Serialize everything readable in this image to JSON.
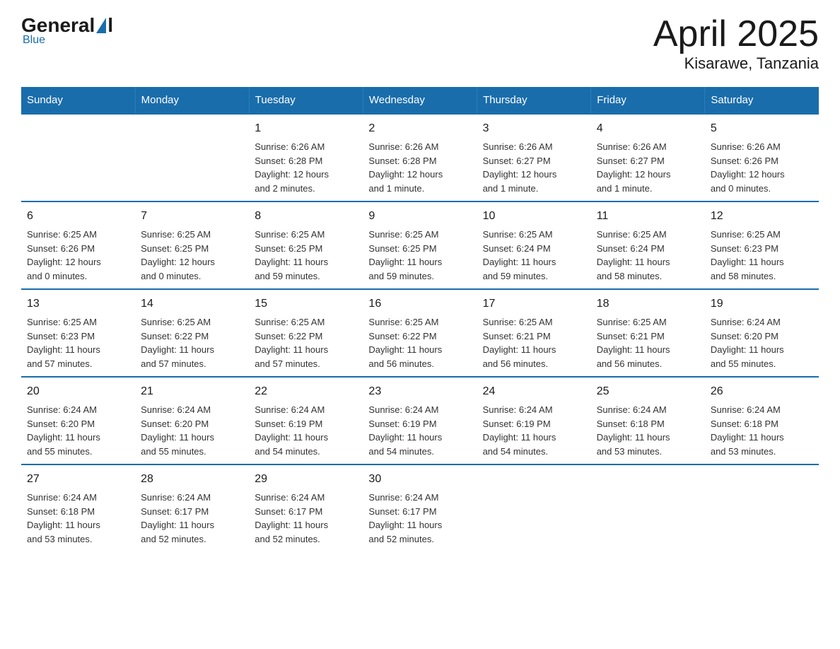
{
  "logo": {
    "general": "General",
    "blue": "Blue"
  },
  "title": "April 2025",
  "location": "Kisarawe, Tanzania",
  "headers": [
    "Sunday",
    "Monday",
    "Tuesday",
    "Wednesday",
    "Thursday",
    "Friday",
    "Saturday"
  ],
  "weeks": [
    [
      {
        "day": "",
        "info": ""
      },
      {
        "day": "",
        "info": ""
      },
      {
        "day": "1",
        "info": "Sunrise: 6:26 AM\nSunset: 6:28 PM\nDaylight: 12 hours\nand 2 minutes."
      },
      {
        "day": "2",
        "info": "Sunrise: 6:26 AM\nSunset: 6:28 PM\nDaylight: 12 hours\nand 1 minute."
      },
      {
        "day": "3",
        "info": "Sunrise: 6:26 AM\nSunset: 6:27 PM\nDaylight: 12 hours\nand 1 minute."
      },
      {
        "day": "4",
        "info": "Sunrise: 6:26 AM\nSunset: 6:27 PM\nDaylight: 12 hours\nand 1 minute."
      },
      {
        "day": "5",
        "info": "Sunrise: 6:26 AM\nSunset: 6:26 PM\nDaylight: 12 hours\nand 0 minutes."
      }
    ],
    [
      {
        "day": "6",
        "info": "Sunrise: 6:25 AM\nSunset: 6:26 PM\nDaylight: 12 hours\nand 0 minutes."
      },
      {
        "day": "7",
        "info": "Sunrise: 6:25 AM\nSunset: 6:25 PM\nDaylight: 12 hours\nand 0 minutes."
      },
      {
        "day": "8",
        "info": "Sunrise: 6:25 AM\nSunset: 6:25 PM\nDaylight: 11 hours\nand 59 minutes."
      },
      {
        "day": "9",
        "info": "Sunrise: 6:25 AM\nSunset: 6:25 PM\nDaylight: 11 hours\nand 59 minutes."
      },
      {
        "day": "10",
        "info": "Sunrise: 6:25 AM\nSunset: 6:24 PM\nDaylight: 11 hours\nand 59 minutes."
      },
      {
        "day": "11",
        "info": "Sunrise: 6:25 AM\nSunset: 6:24 PM\nDaylight: 11 hours\nand 58 minutes."
      },
      {
        "day": "12",
        "info": "Sunrise: 6:25 AM\nSunset: 6:23 PM\nDaylight: 11 hours\nand 58 minutes."
      }
    ],
    [
      {
        "day": "13",
        "info": "Sunrise: 6:25 AM\nSunset: 6:23 PM\nDaylight: 11 hours\nand 57 minutes."
      },
      {
        "day": "14",
        "info": "Sunrise: 6:25 AM\nSunset: 6:22 PM\nDaylight: 11 hours\nand 57 minutes."
      },
      {
        "day": "15",
        "info": "Sunrise: 6:25 AM\nSunset: 6:22 PM\nDaylight: 11 hours\nand 57 minutes."
      },
      {
        "day": "16",
        "info": "Sunrise: 6:25 AM\nSunset: 6:22 PM\nDaylight: 11 hours\nand 56 minutes."
      },
      {
        "day": "17",
        "info": "Sunrise: 6:25 AM\nSunset: 6:21 PM\nDaylight: 11 hours\nand 56 minutes."
      },
      {
        "day": "18",
        "info": "Sunrise: 6:25 AM\nSunset: 6:21 PM\nDaylight: 11 hours\nand 56 minutes."
      },
      {
        "day": "19",
        "info": "Sunrise: 6:24 AM\nSunset: 6:20 PM\nDaylight: 11 hours\nand 55 minutes."
      }
    ],
    [
      {
        "day": "20",
        "info": "Sunrise: 6:24 AM\nSunset: 6:20 PM\nDaylight: 11 hours\nand 55 minutes."
      },
      {
        "day": "21",
        "info": "Sunrise: 6:24 AM\nSunset: 6:20 PM\nDaylight: 11 hours\nand 55 minutes."
      },
      {
        "day": "22",
        "info": "Sunrise: 6:24 AM\nSunset: 6:19 PM\nDaylight: 11 hours\nand 54 minutes."
      },
      {
        "day": "23",
        "info": "Sunrise: 6:24 AM\nSunset: 6:19 PM\nDaylight: 11 hours\nand 54 minutes."
      },
      {
        "day": "24",
        "info": "Sunrise: 6:24 AM\nSunset: 6:19 PM\nDaylight: 11 hours\nand 54 minutes."
      },
      {
        "day": "25",
        "info": "Sunrise: 6:24 AM\nSunset: 6:18 PM\nDaylight: 11 hours\nand 53 minutes."
      },
      {
        "day": "26",
        "info": "Sunrise: 6:24 AM\nSunset: 6:18 PM\nDaylight: 11 hours\nand 53 minutes."
      }
    ],
    [
      {
        "day": "27",
        "info": "Sunrise: 6:24 AM\nSunset: 6:18 PM\nDaylight: 11 hours\nand 53 minutes."
      },
      {
        "day": "28",
        "info": "Sunrise: 6:24 AM\nSunset: 6:17 PM\nDaylight: 11 hours\nand 52 minutes."
      },
      {
        "day": "29",
        "info": "Sunrise: 6:24 AM\nSunset: 6:17 PM\nDaylight: 11 hours\nand 52 minutes."
      },
      {
        "day": "30",
        "info": "Sunrise: 6:24 AM\nSunset: 6:17 PM\nDaylight: 11 hours\nand 52 minutes."
      },
      {
        "day": "",
        "info": ""
      },
      {
        "day": "",
        "info": ""
      },
      {
        "day": "",
        "info": ""
      }
    ]
  ]
}
